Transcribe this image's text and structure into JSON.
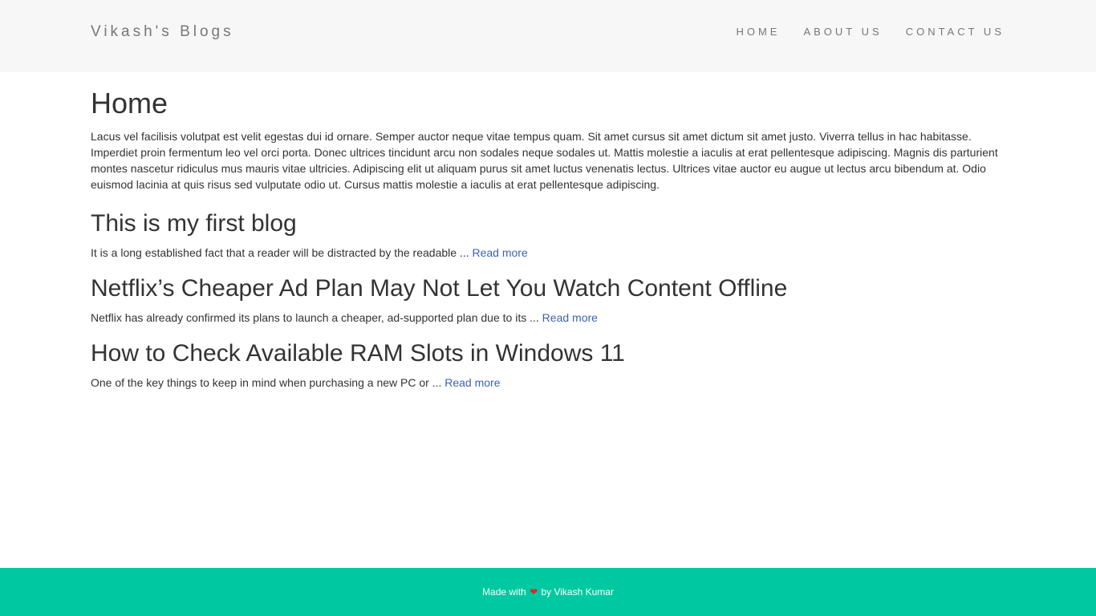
{
  "header": {
    "brand": "Vikash's Blogs",
    "nav": [
      "HOME",
      "ABOUT US",
      "CONTACT US"
    ]
  },
  "main": {
    "title": "Home",
    "intro": "Lacus vel facilisis volutpat est velit egestas dui id ornare. Semper auctor neque vitae tempus quam. Sit amet cursus sit amet dictum sit amet justo. Viverra tellus in hac habitasse. Imperdiet proin fermentum leo vel orci porta. Donec ultrices tincidunt arcu non sodales neque sodales ut. Mattis molestie a iaculis at erat pellentesque adipiscing. Magnis dis parturient montes nascetur ridiculus mus mauris vitae ultricies. Adipiscing elit ut aliquam purus sit amet luctus venenatis lectus. Ultrices vitae auctor eu augue ut lectus arcu bibendum at. Odio euismod lacinia at quis risus sed vulputate odio ut. Cursus mattis molestie a iaculis at erat pellentesque adipiscing.",
    "posts": [
      {
        "title": "This is my first blog",
        "excerpt": "It is a long established fact that a reader will be distracted by the readable ... ",
        "link": "Read more"
      },
      {
        "title": "Netflix’s Cheaper Ad Plan May Not Let You Watch Content Offline",
        "excerpt": "Netflix has already confirmed its plans to launch a cheaper, ad-supported plan due to its ... ",
        "link": "Read more"
      },
      {
        "title": "How to Check Available RAM Slots in Windows 11",
        "excerpt": "One of the key things to keep in mind when purchasing a new PC or ... ",
        "link": "Read more"
      }
    ]
  },
  "footer": {
    "prefix": "Made with ",
    "heart_icon": "heart-icon",
    "heart_glyph": "❤",
    "suffix": " by Vikash Kumar"
  },
  "colors": {
    "header_bg": "#f7f7f7",
    "footer_bg": "#00c9a1",
    "link": "#3b63b5",
    "heart": "#e02424"
  }
}
